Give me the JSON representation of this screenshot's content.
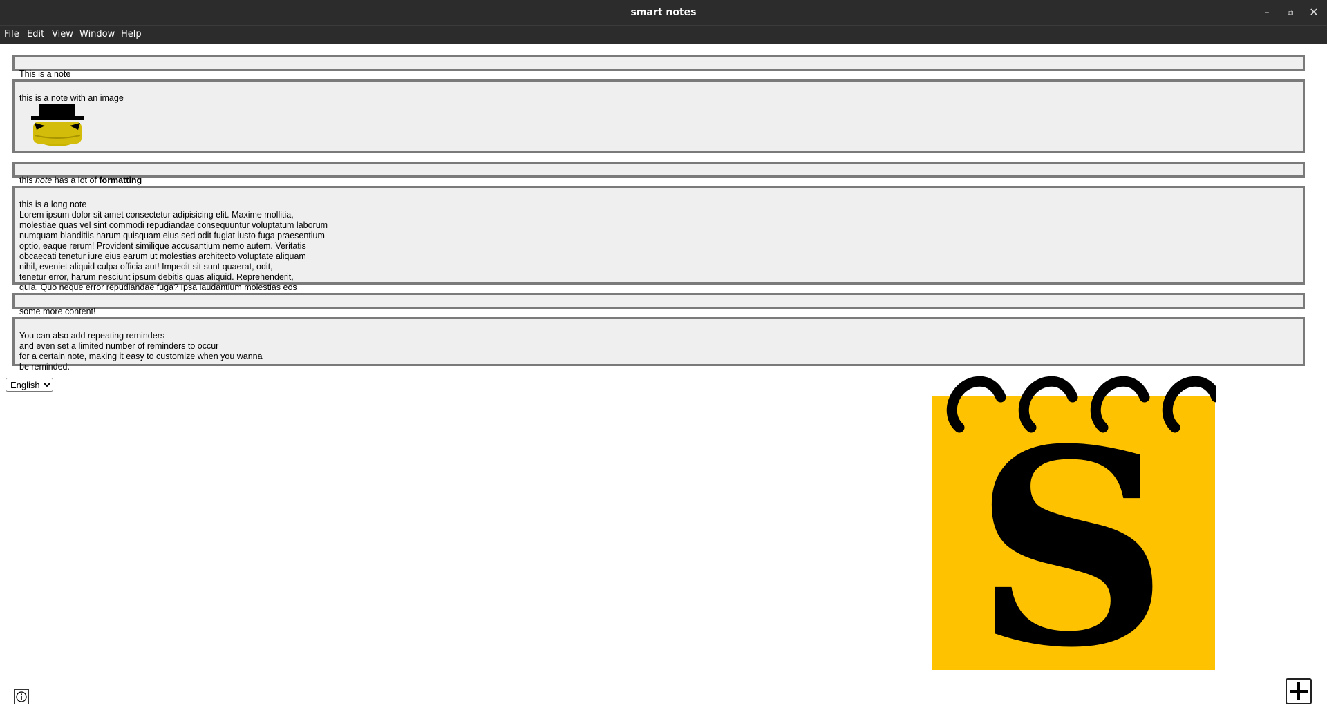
{
  "window": {
    "title": "smart notes",
    "minimize_icon": "minimize-icon",
    "maximize_icon": "restore-icon",
    "close_icon": "close-icon"
  },
  "menubar": {
    "items": [
      "File",
      "Edit",
      "View",
      "Window",
      "Help"
    ]
  },
  "notes": [
    {
      "text": "This is a note"
    },
    {
      "text": "this is a note with an image",
      "image": "hat-face-picture"
    },
    {
      "parts": [
        "this ",
        "note",
        " has a lot of ",
        "formatting"
      ]
    },
    {
      "text": "this is a long note\nLorem ipsum dolor sit amet consectetur adipisicing elit. Maxime mollitia,\nmolestiae quas vel sint commodi repudiandae consequuntur voluptatum laborum\nnumquam blanditiis harum quisquam eius sed odit fugiat iusto fuga praesentium\noptio, eaque rerum! Provident similique accusantium nemo autem. Veritatis\nobcaecati tenetur iure eius earum ut molestias architecto voluptate aliquam\nnihil, eveniet aliquid culpa officia aut! Impedit sit sunt quaerat, odit,\ntenetur error, harum nesciunt ipsum debitis quas aliquid. Reprehenderit,\nquia. Quo neque error repudiandae fuga? Ipsa laudantium molestias eos"
    },
    {
      "text": "some more content!"
    },
    {
      "text": "You can also add repeating reminders\nand even set a limited number of reminders to occur\nfor a certain note, making it easy to customize when you wanna\nbe reminded."
    }
  ],
  "language_select": {
    "selected": "English",
    "options": [
      "English"
    ]
  },
  "logo": {
    "letter": "S",
    "color": "#fec200"
  },
  "footer": {
    "info_icon": "info-icon",
    "add_icon": "plus-icon"
  }
}
